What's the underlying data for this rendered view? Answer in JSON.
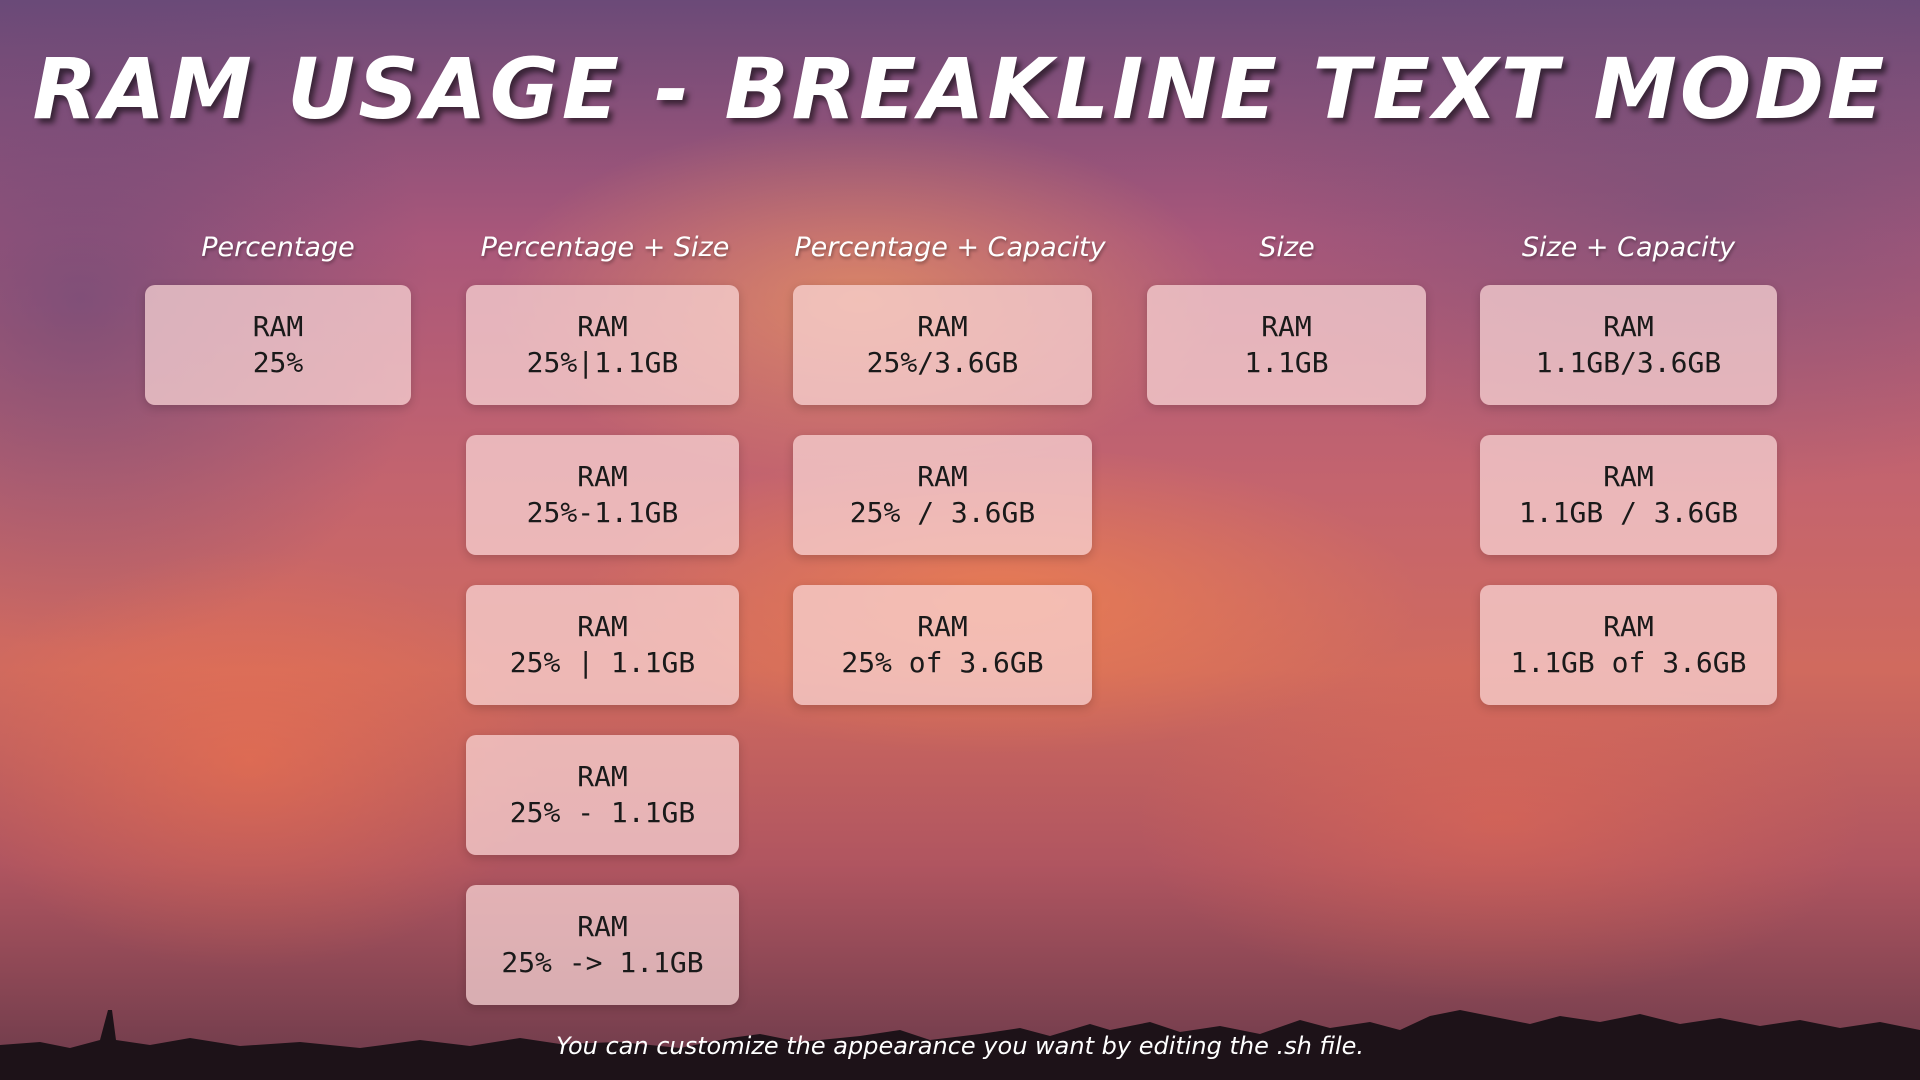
{
  "title": "RAM USAGE - BREAKLINE TEXT MODE",
  "footer": "You can customize the appearance you want by editing the .sh file.",
  "columns": [
    {
      "heading": "Percentage",
      "items": [
        {
          "line1": "RAM",
          "line2": "25%"
        }
      ]
    },
    {
      "heading": "Percentage + Size",
      "items": [
        {
          "line1": "RAM",
          "line2": "25%|1.1GB"
        },
        {
          "line1": "RAM",
          "line2": "25%-1.1GB"
        },
        {
          "line1": "RAM",
          "line2": "25% | 1.1GB"
        },
        {
          "line1": "RAM",
          "line2": "25% - 1.1GB"
        },
        {
          "line1": "RAM",
          "line2": "25% -> 1.1GB"
        }
      ]
    },
    {
      "heading": "Percentage + Capacity",
      "items": [
        {
          "line1": "RAM",
          "line2": "25%/3.6GB"
        },
        {
          "line1": "RAM",
          "line2": "25% / 3.6GB"
        },
        {
          "line1": "RAM",
          "line2": "25% of 3.6GB"
        }
      ]
    },
    {
      "heading": "Size",
      "items": [
        {
          "line1": "RAM",
          "line2": "1.1GB"
        }
      ]
    },
    {
      "heading": "Size + Capacity",
      "items": [
        {
          "line1": "RAM",
          "line2": "1.1GB/3.6GB"
        },
        {
          "line1": "RAM",
          "line2": "1.1GB / 3.6GB"
        },
        {
          "line1": "RAM",
          "line2": "1.1GB of 3.6GB"
        }
      ]
    }
  ]
}
